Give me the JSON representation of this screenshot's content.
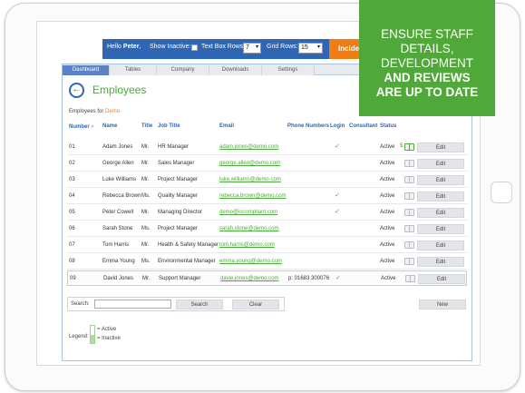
{
  "topbar": {
    "greeting_prefix": "Hello",
    "user": "Peter",
    "greeting_suffix": ",",
    "show_inactive_label": "Show Inactive:",
    "text_box_rows_label": "Text Box Rows:",
    "text_box_rows_value": "7",
    "grid_rows_label": "Grid Rows:",
    "grid_rows_value": "15",
    "incident_label": "Incident"
  },
  "tabs": [
    "Dashboard",
    "Tables",
    "Company",
    "Downloads",
    "Settings"
  ],
  "active_tab": "Dashboard",
  "page": {
    "title": "Employees",
    "subtitle_prefix": "Employees for",
    "org": "Demo"
  },
  "table": {
    "headers": [
      "Number",
      "Name",
      "Title",
      "Job Title",
      "Email",
      "Phone Numbers",
      "Login",
      "Consultant",
      "Status"
    ],
    "rows": [
      {
        "number": "01",
        "name": "Adam Jones",
        "title": "Mr.",
        "job": "HR Manager",
        "email": "adam.jones@demo.com",
        "phone": "",
        "login": true,
        "status": "Active",
        "dollar": true,
        "book_green": true,
        "edit": "Edit"
      },
      {
        "number": "02",
        "name": "George Allen",
        "title": "Mr.",
        "job": "Sales Manager",
        "email": "george.allen@demo.com",
        "phone": "",
        "login": false,
        "status": "Active",
        "dollar": false,
        "book_green": false,
        "edit": "Edit"
      },
      {
        "number": "03",
        "name": "Luke Williams",
        "title": "Mr.",
        "job": "Project Manager",
        "email": "luke.williams@demo.com",
        "phone": "",
        "login": false,
        "status": "Active",
        "dollar": false,
        "book_green": false,
        "edit": "Edit"
      },
      {
        "number": "04",
        "name": "Rebecca Brown",
        "title": "Ms.",
        "job": "Quality Manager",
        "email": "rebecca.brown@demo.com",
        "phone": "",
        "login": true,
        "status": "Active",
        "dollar": false,
        "book_green": false,
        "edit": "Edit"
      },
      {
        "number": "05",
        "name": "Peter Cowell",
        "title": "Mr.",
        "job": "Managing Director",
        "email": "demo@iscompliant.com",
        "phone": "",
        "login": true,
        "status": "Active",
        "dollar": false,
        "book_green": false,
        "edit": "Edit"
      },
      {
        "number": "06",
        "name": "Sarah Stone",
        "title": "Ms.",
        "job": "Project Manager",
        "email": "sarah.stone@demo.com",
        "phone": "",
        "login": false,
        "status": "Active",
        "dollar": false,
        "book_green": false,
        "edit": "Edit"
      },
      {
        "number": "07",
        "name": "Tom Harris",
        "title": "Mr.",
        "job": "Health & Safety Manager",
        "email": "tom.harris@demo.com",
        "phone": "",
        "login": false,
        "status": "Active",
        "dollar": false,
        "book_green": false,
        "edit": "Edit"
      },
      {
        "number": "08",
        "name": "Emma Young",
        "title": "Ms.",
        "job": "Environmental Manager",
        "email": "emma.young@demo.com",
        "phone": "",
        "login": false,
        "status": "Active",
        "dollar": false,
        "book_green": false,
        "edit": "Edit"
      },
      {
        "number": "09",
        "name": "David Jones",
        "title": "Mr.",
        "job": "Support Manager",
        "email": "davie.jones@demo.com",
        "phone": "p: 01683 300076",
        "login": true,
        "status": "Active",
        "dollar": false,
        "book_green": false,
        "edit": "Edit"
      }
    ]
  },
  "search": {
    "label": "Search:",
    "search_button": "Search",
    "clear_button": "Clear",
    "new_button": "New"
  },
  "legend": {
    "label": "Legend:",
    "active": "= Active",
    "inactive": "= Inactive"
  },
  "callout": {
    "lines": [
      "ENSURE STAFF",
      "DETAILS,",
      "DEVELOPMENT"
    ],
    "bold_lines": [
      "AND REVIEWS",
      "ARE UP TO DATE"
    ]
  },
  "colors": {
    "brand_blue": "#2f66b3",
    "accent_green": "#4caa3a",
    "callout_green": "#51a83a",
    "incident_orange": "#ef7d13"
  }
}
